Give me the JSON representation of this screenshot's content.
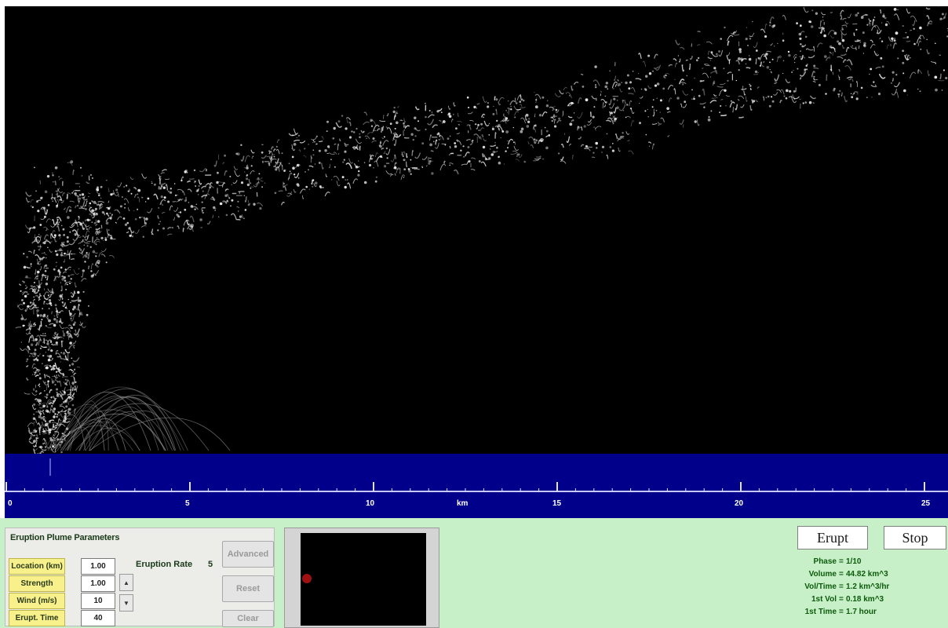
{
  "parameters": {
    "title": "Eruption Plume Parameters",
    "rows": [
      {
        "label": "Location (km)",
        "value": "1.00"
      },
      {
        "label": "Strength",
        "value": "1.00"
      },
      {
        "label": "Wind (m/s)",
        "value": "10"
      },
      {
        "label": "Erupt. Time",
        "value": "40"
      }
    ],
    "eruption_label": "Eruption Rate",
    "eruption_value": "5",
    "buttons": {
      "advanced": "Advanced",
      "reset": "Reset",
      "clear": "Clear"
    }
  },
  "stepper": {
    "up": "▲",
    "down": "▼"
  },
  "ruler": {
    "labels": [
      "0",
      "5",
      "10",
      "km",
      "15",
      "20",
      "25"
    ]
  },
  "controls": {
    "start_label": "Erupt",
    "stop_label": "Stop"
  },
  "stats": [
    {
      "label": "Phase",
      "eq": "=",
      "value": "1/10"
    },
    {
      "label": "Volume",
      "eq": "=",
      "value": "44.82 km^3"
    },
    {
      "label": "Vol/Time",
      "eq": "=",
      "value": "1.2 km^3/hr"
    },
    {
      "label": "1st Vol",
      "eq": "=",
      "value": "0.18 km^3"
    },
    {
      "label": "1st Time",
      "eq": "=",
      "value": "1.7 hour"
    }
  ],
  "colors": {
    "sky": "#000000",
    "ground": "#00008b",
    "panel": "#c8f0c8",
    "label_bg": "#f8f08a",
    "stat_text": "#0b5a0b",
    "particle": "#e8e8e8"
  }
}
